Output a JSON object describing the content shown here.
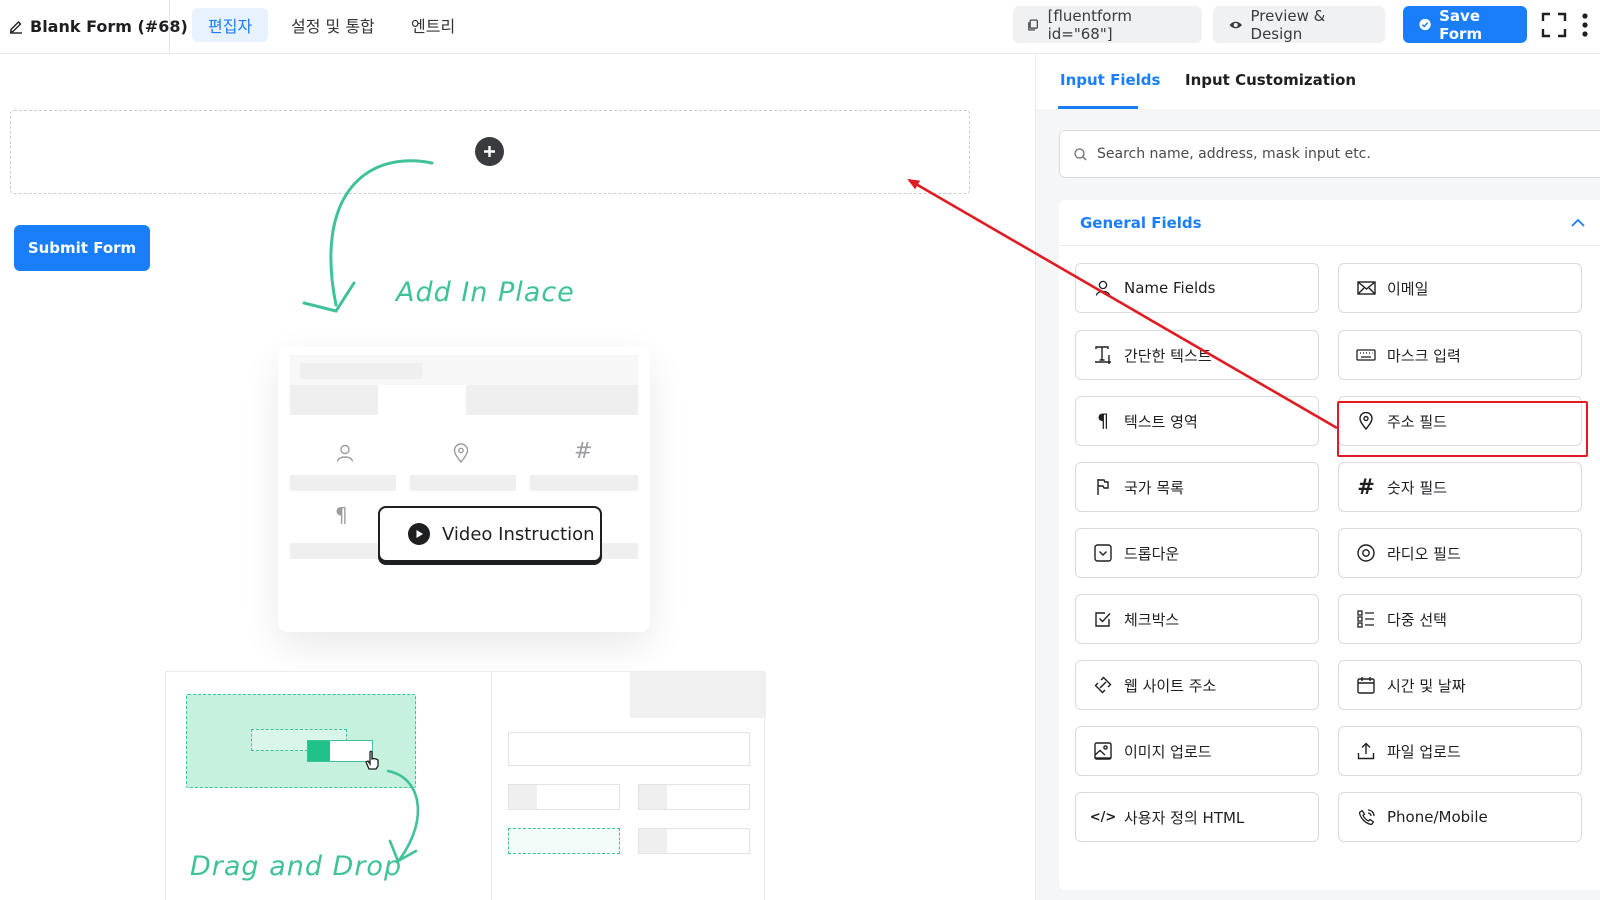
{
  "topbar": {
    "form_title": "Blank Form (#68)",
    "tabs": [
      {
        "label": "편집자",
        "active": true
      },
      {
        "label": "설정 및 통합",
        "active": false
      },
      {
        "label": "엔트리",
        "active": false
      }
    ],
    "shortcode": "[fluentform id=\"68\"]",
    "preview_label": "Preview & Design",
    "save_label": "Save Form"
  },
  "canvas": {
    "submit_label": "Submit Form",
    "add_in_place": "Add In Place",
    "video_instruction": "Video Instruction",
    "drag_and_drop": "Drag and Drop"
  },
  "panel": {
    "tabs": [
      {
        "label": "Input Fields",
        "active": true
      },
      {
        "label": "Input Customization",
        "active": false
      }
    ],
    "search_placeholder": "Search name, address, mask input etc.",
    "section_title": "General Fields",
    "fields": [
      {
        "label": "Name Fields",
        "icon": "user-icon"
      },
      {
        "label": "이메일",
        "icon": "envelope-icon"
      },
      {
        "label": "간단한 텍스트",
        "icon": "text-icon"
      },
      {
        "label": "마스크 입력",
        "icon": "keyboard-icon"
      },
      {
        "label": "텍스트 영역",
        "icon": "paragraph-icon"
      },
      {
        "label": "주소 필드",
        "icon": "map-pin-icon"
      },
      {
        "label": "국가 목록",
        "icon": "flag-icon"
      },
      {
        "label": "숫자 필드",
        "icon": "hash-icon"
      },
      {
        "label": "드롭다운",
        "icon": "dropdown-icon"
      },
      {
        "label": "라디오 필드",
        "icon": "radio-icon"
      },
      {
        "label": "체크박스",
        "icon": "checkbox-icon"
      },
      {
        "label": "다중 선택",
        "icon": "list-icon"
      },
      {
        "label": "웹 사이트 주소",
        "icon": "link-icon"
      },
      {
        "label": "시간 및 날짜",
        "icon": "calendar-icon"
      },
      {
        "label": "이미지 업로드",
        "icon": "image-icon"
      },
      {
        "label": "파일 업로드",
        "icon": "upload-icon"
      },
      {
        "label": "사용자 정의 HTML",
        "icon": "code-icon"
      },
      {
        "label": "Phone/Mobile",
        "icon": "phone-icon"
      }
    ]
  },
  "colors": {
    "accent": "#1a7efb",
    "hand_green": "#3fc29a",
    "highlight_red": "#e11b22"
  }
}
